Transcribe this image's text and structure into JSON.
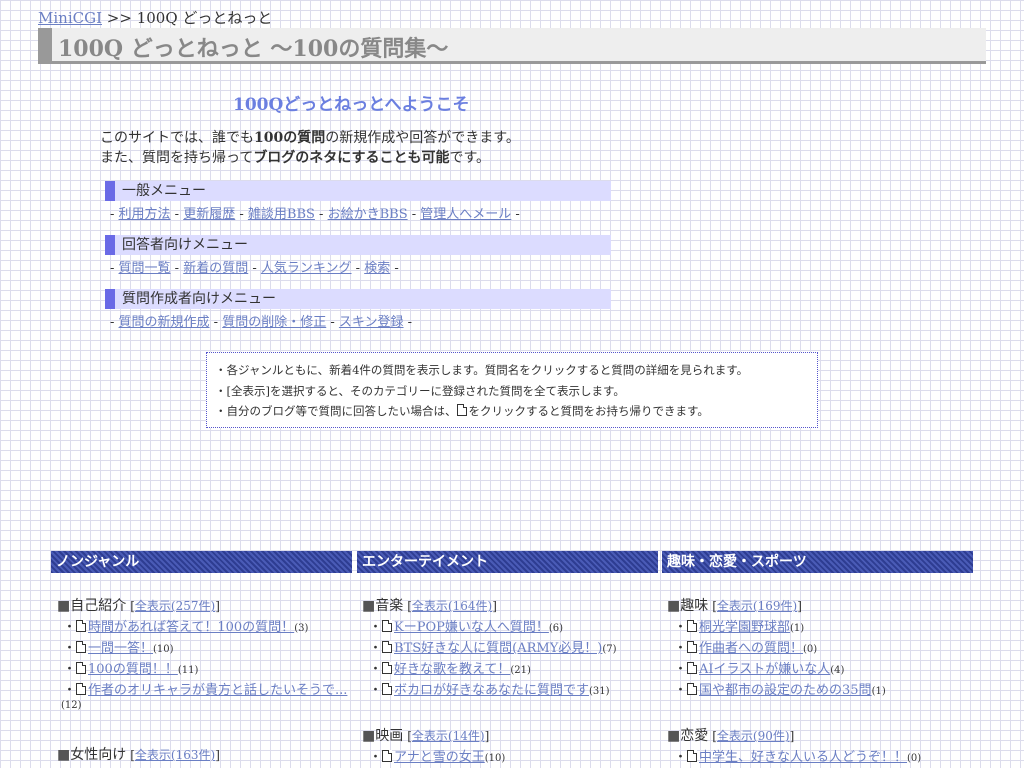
{
  "breadcrumb": {
    "home": "MiniCGI",
    "sep": " >> ",
    "current": "100Q どっとねっと"
  },
  "page_title": "100Q どっとねっと ～100の質問集～",
  "welcome": "100Qどっとねっとへようこそ",
  "intro": {
    "l1a": "このサイトでは、誰でも",
    "l1b": "100の質問",
    "l1c": "の新規作成や回答ができます。",
    "l2a": "また、質問を持ち帰って",
    "l2b": "ブログのネタにすることも可能",
    "l2c": "です。"
  },
  "sep": " - ",
  "menus": {
    "general": {
      "title": "一般メニュー",
      "links": [
        "利用方法",
        "更新履歴",
        "雑談用BBS",
        "お絵かきBBS",
        "管理人へメール"
      ]
    },
    "answerer": {
      "title": "回答者向けメニュー",
      "links": [
        "質問一覧",
        "新着の質問",
        "人気ランキング",
        "検索"
      ]
    },
    "creator": {
      "title": "質問作成者向けメニュー",
      "links": [
        "質問の新規作成",
        "質問の削除・修正",
        "スキン登録"
      ]
    }
  },
  "notice": {
    "l1": "・各ジャンルともに、新着4件の質問を表示します。質問名をクリックすると質問の詳細を見られます。",
    "l2": "・[全表示]を選択すると、そのカテゴリーに登録された質問を全て表示します。",
    "l3a": "・自分のブログ等で質問に回答したい場合は、",
    "l3b": "をクリックすると質問をお持ち帰りできます。"
  },
  "genres": {
    "nongenre": {
      "title": "ノンジャンル",
      "cats": {
        "self": {
          "name": "自己紹介",
          "all": "全表示(257件)",
          "items": [
            {
              "title": "時間があれば答えて！100の質問！",
              "count": "(3)"
            },
            {
              "title": "一問一答！",
              "count": "(10)"
            },
            {
              "title": "100の質問！！",
              "count": "(11)"
            },
            {
              "title": "作者のオリキャラが貴方と話したいそうで...",
              "count": "(12)"
            }
          ]
        },
        "women": {
          "name": "女性向け",
          "all": "全表示(163件)"
        }
      }
    },
    "entertainment": {
      "title": "エンターテイメント",
      "cats": {
        "music": {
          "name": "音楽",
          "all": "全表示(164件)",
          "items": [
            {
              "title": "KーPOP嫌いな人へ質問！",
              "count": "(6)"
            },
            {
              "title": "BTS好きな人に質問(ARMY必見！)",
              "count": "(7)"
            },
            {
              "title": "好きな歌を教えて！",
              "count": "(21)"
            },
            {
              "title": "ボカロが好きなあなたに質問です",
              "count": "(31)"
            }
          ]
        },
        "movie": {
          "name": "映画",
          "all": "全表示(14件)",
          "items": [
            {
              "title": "アナと雪の女王",
              "count": "(10)"
            }
          ]
        }
      }
    },
    "hobby": {
      "title": "趣味・恋愛・スポーツ",
      "cats": {
        "hobby": {
          "name": "趣味",
          "all": "全表示(169件)",
          "items": [
            {
              "title": "桐光学園野球部",
              "count": "(1)"
            },
            {
              "title": "作曲者への質問！",
              "count": "(0)"
            },
            {
              "title": "AIイラストが嫌いな人",
              "count": "(4)"
            },
            {
              "title": "国や都市の設定のための35問",
              "count": "(1)"
            }
          ]
        },
        "love": {
          "name": "恋愛",
          "all": "全表示(90件)",
          "items": [
            {
              "title": "中学生、好きな人いる人どうぞ！！",
              "count": "(0)"
            }
          ]
        }
      }
    }
  },
  "symbols": {
    "square": "■",
    "dot": "・",
    "lb": "[",
    "rb": "]"
  }
}
